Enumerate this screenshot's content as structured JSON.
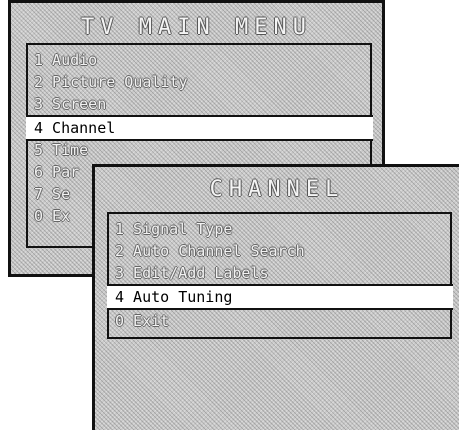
{
  "main_menu": {
    "title": "TV MAIN MENU",
    "items": [
      {
        "label": "1 Audio"
      },
      {
        "label": "2 Picture Quality"
      },
      {
        "label": "3 Screen"
      },
      {
        "label": "4 Channel",
        "selected": true
      },
      {
        "label": "5 Time"
      },
      {
        "label": "6 Par"
      },
      {
        "label": "7 Se"
      },
      {
        "label": "0 Ex"
      }
    ]
  },
  "channel_menu": {
    "title": "CHANNEL",
    "items": [
      {
        "label": "1 Signal Type"
      },
      {
        "label": "2 Auto Channel Search"
      },
      {
        "label": "3 Edit/Add Labels"
      },
      {
        "label": "4 Auto Tuning",
        "selected": true
      },
      {
        "label": "0 Exit"
      }
    ]
  }
}
